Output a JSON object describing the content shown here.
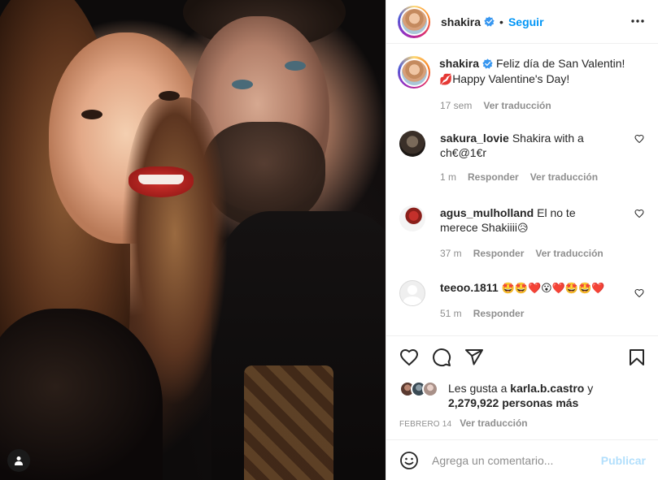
{
  "header": {
    "username": "shakira",
    "separator": "•",
    "follow_label": "Seguir"
  },
  "caption": {
    "username": "shakira",
    "line1": "Feliz día de San Valentin!",
    "line2_emoji": "💋",
    "line2": "Happy Valentine's Day!",
    "age": "17 sem",
    "translate_label": "Ver traducción"
  },
  "comments": [
    {
      "username": "sakura_lovie",
      "text": "Shakira with a ch€@1€r",
      "age": "1 m",
      "reply_label": "Responder",
      "translate_label": "Ver traducción"
    },
    {
      "username": "agus_mulholland",
      "text": "El no te merece Shakiiii",
      "text_emoji": "😥",
      "age": "37 m",
      "reply_label": "Responder",
      "translate_label": "Ver traducción"
    },
    {
      "username": "teeoo.1811",
      "text": "🤩🤩❤️😮❤️🤩🤩❤️",
      "age": "51 m",
      "reply_label": "Responder"
    }
  ],
  "likes": {
    "prefix": "Les gusta a",
    "user": "karla.b.castro",
    "connector": "y",
    "count": "2,279,922",
    "suffix": "personas más"
  },
  "post_date": "FEBRERO 14",
  "post_translate_label": "Ver traducción",
  "add_comment": {
    "placeholder": "Agrega un comentario...",
    "publish_label": "Publicar"
  },
  "colors": {
    "link_blue": "#0095f6",
    "publish_disabled": "#b2dffc",
    "secondary_text": "#8e8e8e",
    "border": "#efefef"
  }
}
